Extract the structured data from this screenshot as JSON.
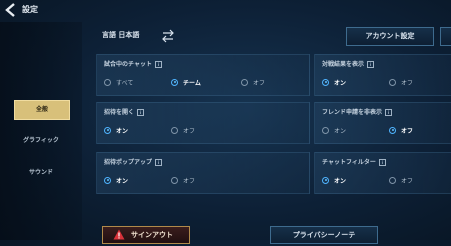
{
  "header": {
    "title": "設定"
  },
  "sidebar": {
    "items": [
      {
        "label": "全般"
      },
      {
        "label": "グラフィック"
      },
      {
        "label": "サウンド"
      }
    ]
  },
  "language": {
    "label": "言語 日本語"
  },
  "buttons": {
    "account": "アカウント設定",
    "signout": "サインアウト",
    "privacy": "プライバシーノーテ"
  },
  "settings": [
    {
      "title": "試合中のチャット",
      "options": [
        "すべて",
        "チーム",
        "オフ"
      ],
      "selected": "チーム"
    },
    {
      "title": "招待を開く",
      "options": [
        "オン",
        "オフ"
      ],
      "selected": "オン"
    },
    {
      "title": "招待ポップアップ",
      "options": [
        "オン",
        "オフ"
      ],
      "selected": "オン"
    },
    {
      "title": "対戦結果を表示",
      "options": [
        "オン",
        "オフ"
      ],
      "selected": "オン"
    },
    {
      "title": "フレンド申請を非表示",
      "options": [
        "オン",
        "オフ"
      ],
      "selected": "オフ"
    },
    {
      "title": "チャットフィルター",
      "options": [
        "オン",
        "オフ"
      ],
      "selected": "オン"
    }
  ],
  "colors": {
    "accent": "#4fb4ff",
    "active_tab": "#d8c07a"
  }
}
